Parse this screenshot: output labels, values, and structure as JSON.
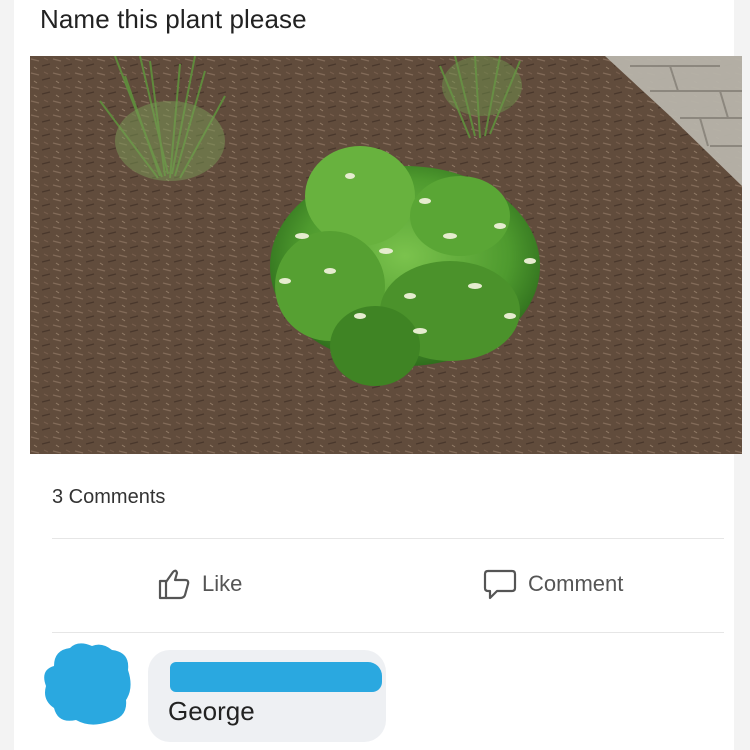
{
  "post": {
    "text": "Name this plant please",
    "comments_count": "3 Comments"
  },
  "actions": {
    "like_label": "Like",
    "comment_label": "Comment"
  },
  "comment": {
    "author": "George"
  },
  "colors": {
    "redaction": "#2aa8e0",
    "bubble": "#eef0f3",
    "icon": "#555555"
  },
  "icons": {
    "like": "thumbs-up-icon",
    "comment": "speech-bubble-icon"
  }
}
